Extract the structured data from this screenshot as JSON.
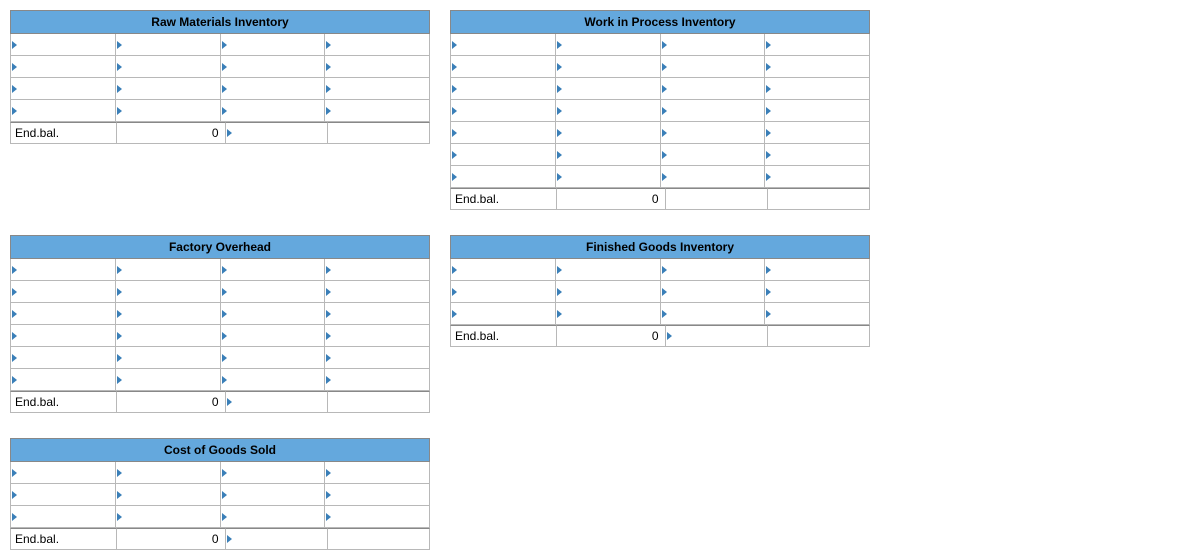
{
  "accounts": {
    "rmi": {
      "title": "Raw Materials Inventory",
      "endbal_label": "End.bal.",
      "endbal_value": "0"
    },
    "wip": {
      "title": "Work in Process Inventory",
      "endbal_label": "End.bal.",
      "endbal_value": "0"
    },
    "fo": {
      "title": "Factory Overhead",
      "endbal_label": "End.bal.",
      "endbal_value": "0"
    },
    "fgi": {
      "title": "Finished Goods Inventory",
      "endbal_label": "End.bal.",
      "endbal_value": "0"
    },
    "cogs": {
      "title": "Cost of Goods Sold",
      "endbal_label": "End.bal.",
      "endbal_value": "0"
    }
  }
}
